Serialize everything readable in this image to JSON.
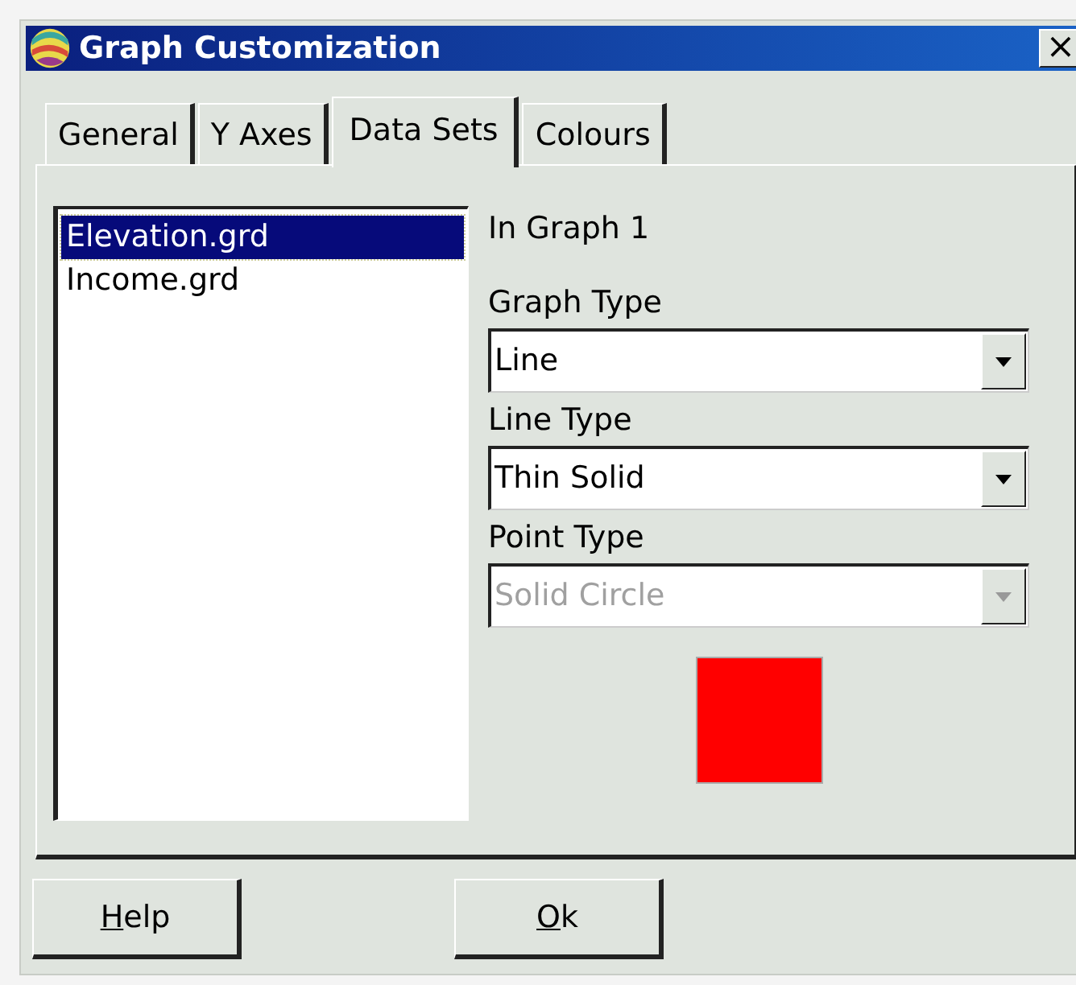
{
  "window": {
    "title": "Graph Customization",
    "close": "×"
  },
  "tabs": [
    {
      "label": "General",
      "selected": false
    },
    {
      "label": "Y Axes",
      "selected": false
    },
    {
      "label": "Data Sets",
      "selected": true
    },
    {
      "label": "Colours",
      "selected": false
    }
  ],
  "data_sets": [
    {
      "label": "Elevation.grd",
      "selected": true
    },
    {
      "label": "Income.grd",
      "selected": false
    }
  ],
  "graph_heading": "In Graph 1",
  "fields": [
    {
      "label": "Graph Type",
      "value": "Line",
      "disabled": false
    },
    {
      "label": "Line Type",
      "value": "Thin Solid",
      "disabled": false
    },
    {
      "label": "Point Type",
      "value": "Solid Circle",
      "disabled": true
    }
  ],
  "swatch": {
    "color": "#ff0000"
  },
  "buttons": [
    {
      "key": "H",
      "rest": "elp"
    },
    {
      "key": "O",
      "rest": "k"
    }
  ]
}
